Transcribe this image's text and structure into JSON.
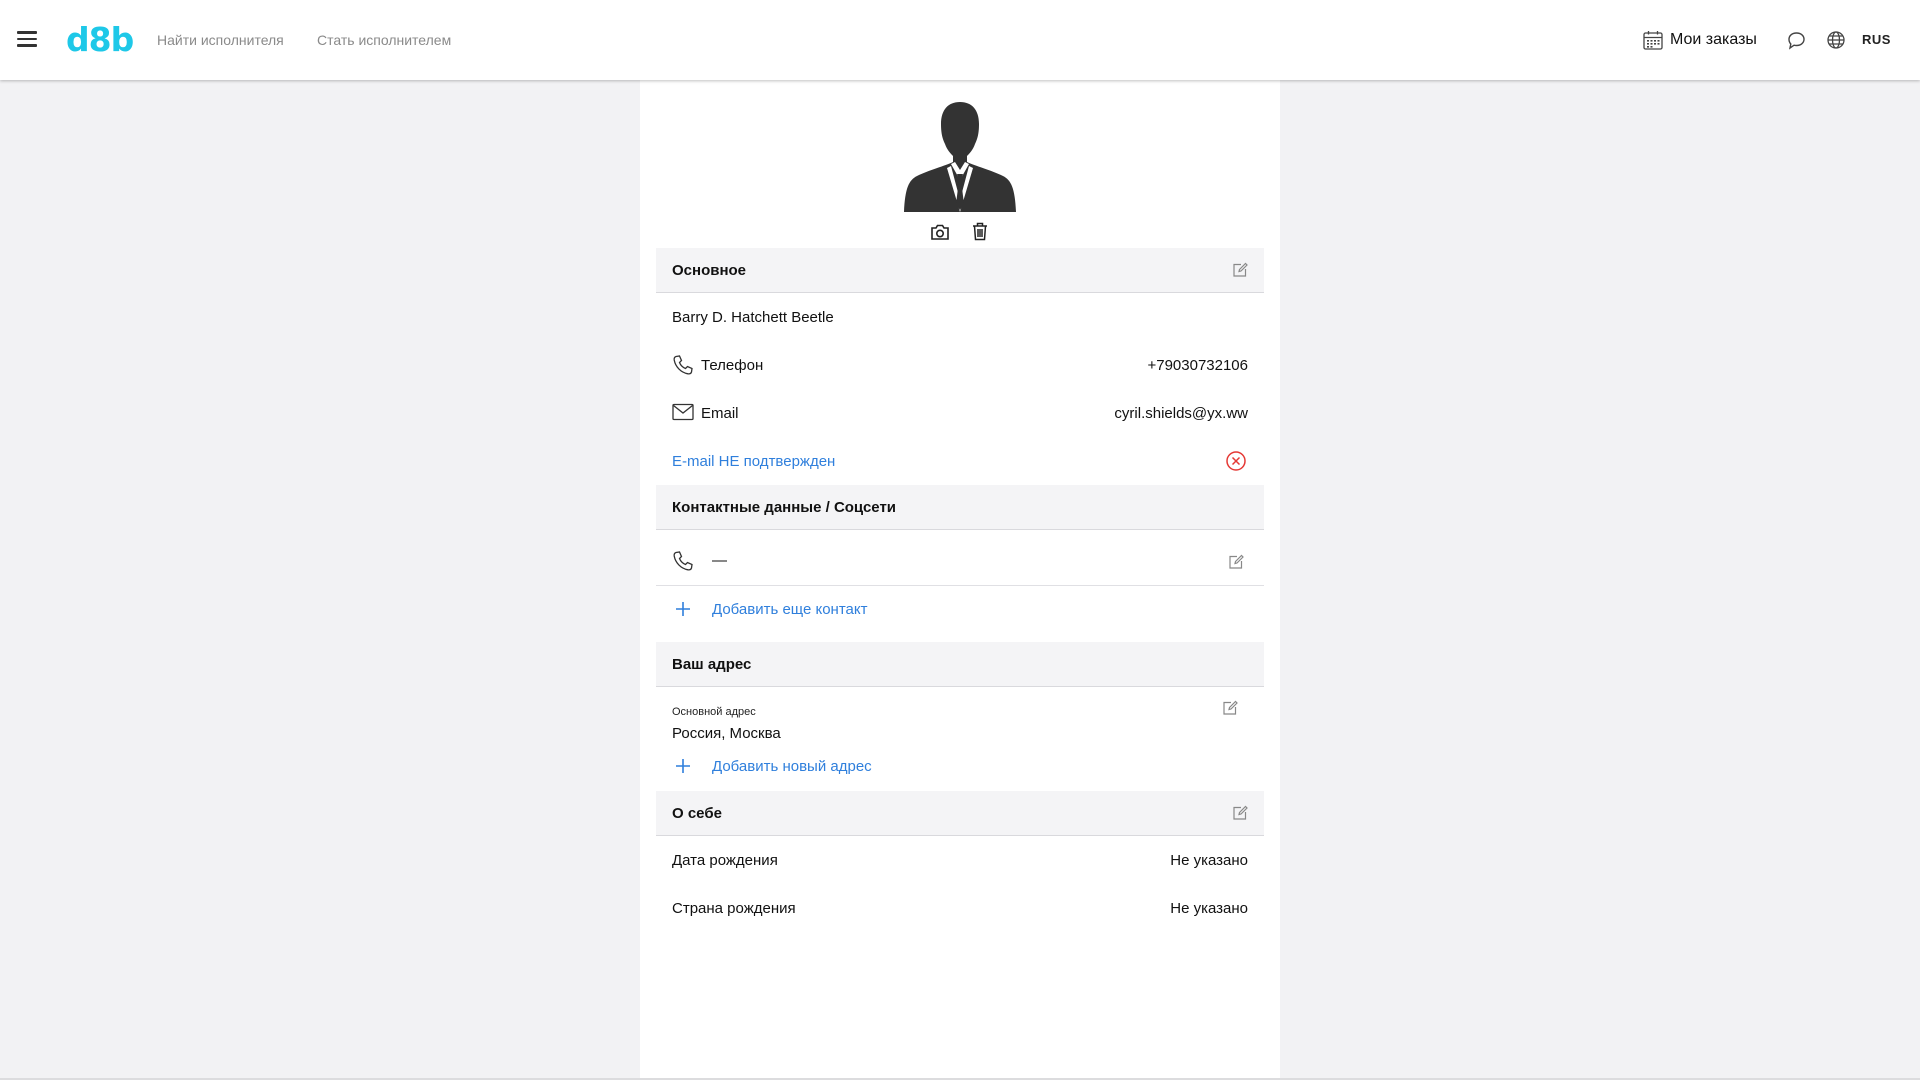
{
  "header": {
    "logo": "d8b",
    "nav": {
      "find": "Найти исполнителя",
      "become": "Стать исполнителем"
    },
    "orders_label": "Мои заказы",
    "language": "RUS"
  },
  "colors": {
    "brand": "#1ec8e8",
    "link": "#2f7fdc",
    "error": "#e53935",
    "section_bg": "#f4f4f6",
    "page_bg": "#f2f2f4"
  },
  "profile": {
    "basic": {
      "title": "Основное",
      "name": "Barry D. Hatchett Beetle",
      "phone_label": "Телефон",
      "phone_value": "+79030732106",
      "email_label": "Email",
      "email_value": "cyril.shields@yx.ww",
      "email_status": "E-mail НЕ подтвержден"
    },
    "contacts": {
      "title": "Контактные данные / Соцсети",
      "phone_value": "—",
      "add_label": "Добавить еще контакт"
    },
    "address": {
      "title": "Ваш адрес",
      "main_label": "Основной адрес",
      "main_value": "Россия, Москва",
      "add_label": "Добавить новый адрес"
    },
    "about": {
      "title": "О себе",
      "birth_date_label": "Дата рождения",
      "birth_date_value": "Не указано",
      "birth_country_label": "Страна рождения",
      "birth_country_value": "Не указано"
    }
  },
  "icons": [
    "menu-icon",
    "calendar-icon",
    "chat-icon",
    "globe-icon",
    "avatar-placeholder",
    "camera-icon",
    "trash-icon",
    "edit-icon",
    "phone-icon",
    "mail-icon",
    "error-circle-icon",
    "plus-icon"
  ]
}
